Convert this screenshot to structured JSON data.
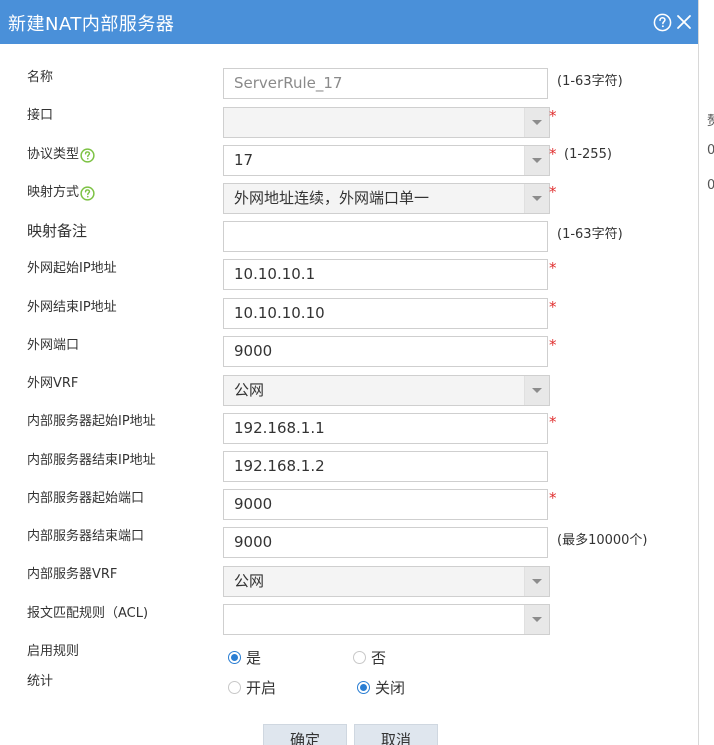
{
  "dialog": {
    "title": "新建NAT内部服务器"
  },
  "background_fragments": [
    "赘",
    "0",
    "0"
  ],
  "fields": {
    "name": {
      "label": "名称",
      "placeholder": "ServerRule_17",
      "hint": "(1-63字符)"
    },
    "interface": {
      "label": "接口",
      "value": ""
    },
    "protocol": {
      "label": "协议类型",
      "value": "17",
      "hint": "(1-255)"
    },
    "mapping_mode": {
      "label": "映射方式",
      "value": "外网地址连续，外网端口单一"
    },
    "mapping_note": {
      "label": "映射备注",
      "value": "",
      "hint": "(1-63字符)"
    },
    "ext_start_ip": {
      "label": "外网起始IP地址",
      "value": "10.10.10.1"
    },
    "ext_end_ip": {
      "label": "外网结束IP地址",
      "value": "10.10.10.10"
    },
    "ext_port": {
      "label": "外网端口",
      "value": "9000"
    },
    "ext_vrf": {
      "label": "外网VRF",
      "value": "公网"
    },
    "int_start_ip": {
      "label": "内部服务器起始IP地址",
      "value": "192.168.1.1"
    },
    "int_end_ip": {
      "label": "内部服务器结束IP地址",
      "value": "192.168.1.2"
    },
    "int_start_port": {
      "label": "内部服务器起始端口",
      "value": "9000"
    },
    "int_end_port": {
      "label": "内部服务器结束端口",
      "value": "9000",
      "hint": "(最多10000个)"
    },
    "int_vrf": {
      "label": "内部服务器VRF",
      "value": "公网"
    },
    "acl": {
      "label": "报文匹配规则（ACL)",
      "value": ""
    }
  },
  "enable_rule": {
    "label": "启用规则",
    "yes": "是",
    "no": "否",
    "selected": "yes"
  },
  "statistics": {
    "label": "统计",
    "on": "开启",
    "off": "关闭",
    "selected": "off"
  },
  "buttons": {
    "confirm": "确定",
    "cancel": "取消"
  },
  "required_mark": "*",
  "colors": {
    "titlebar": "#4a90d9",
    "radio_selected": "#2a7ed3",
    "required": "#e03030"
  }
}
